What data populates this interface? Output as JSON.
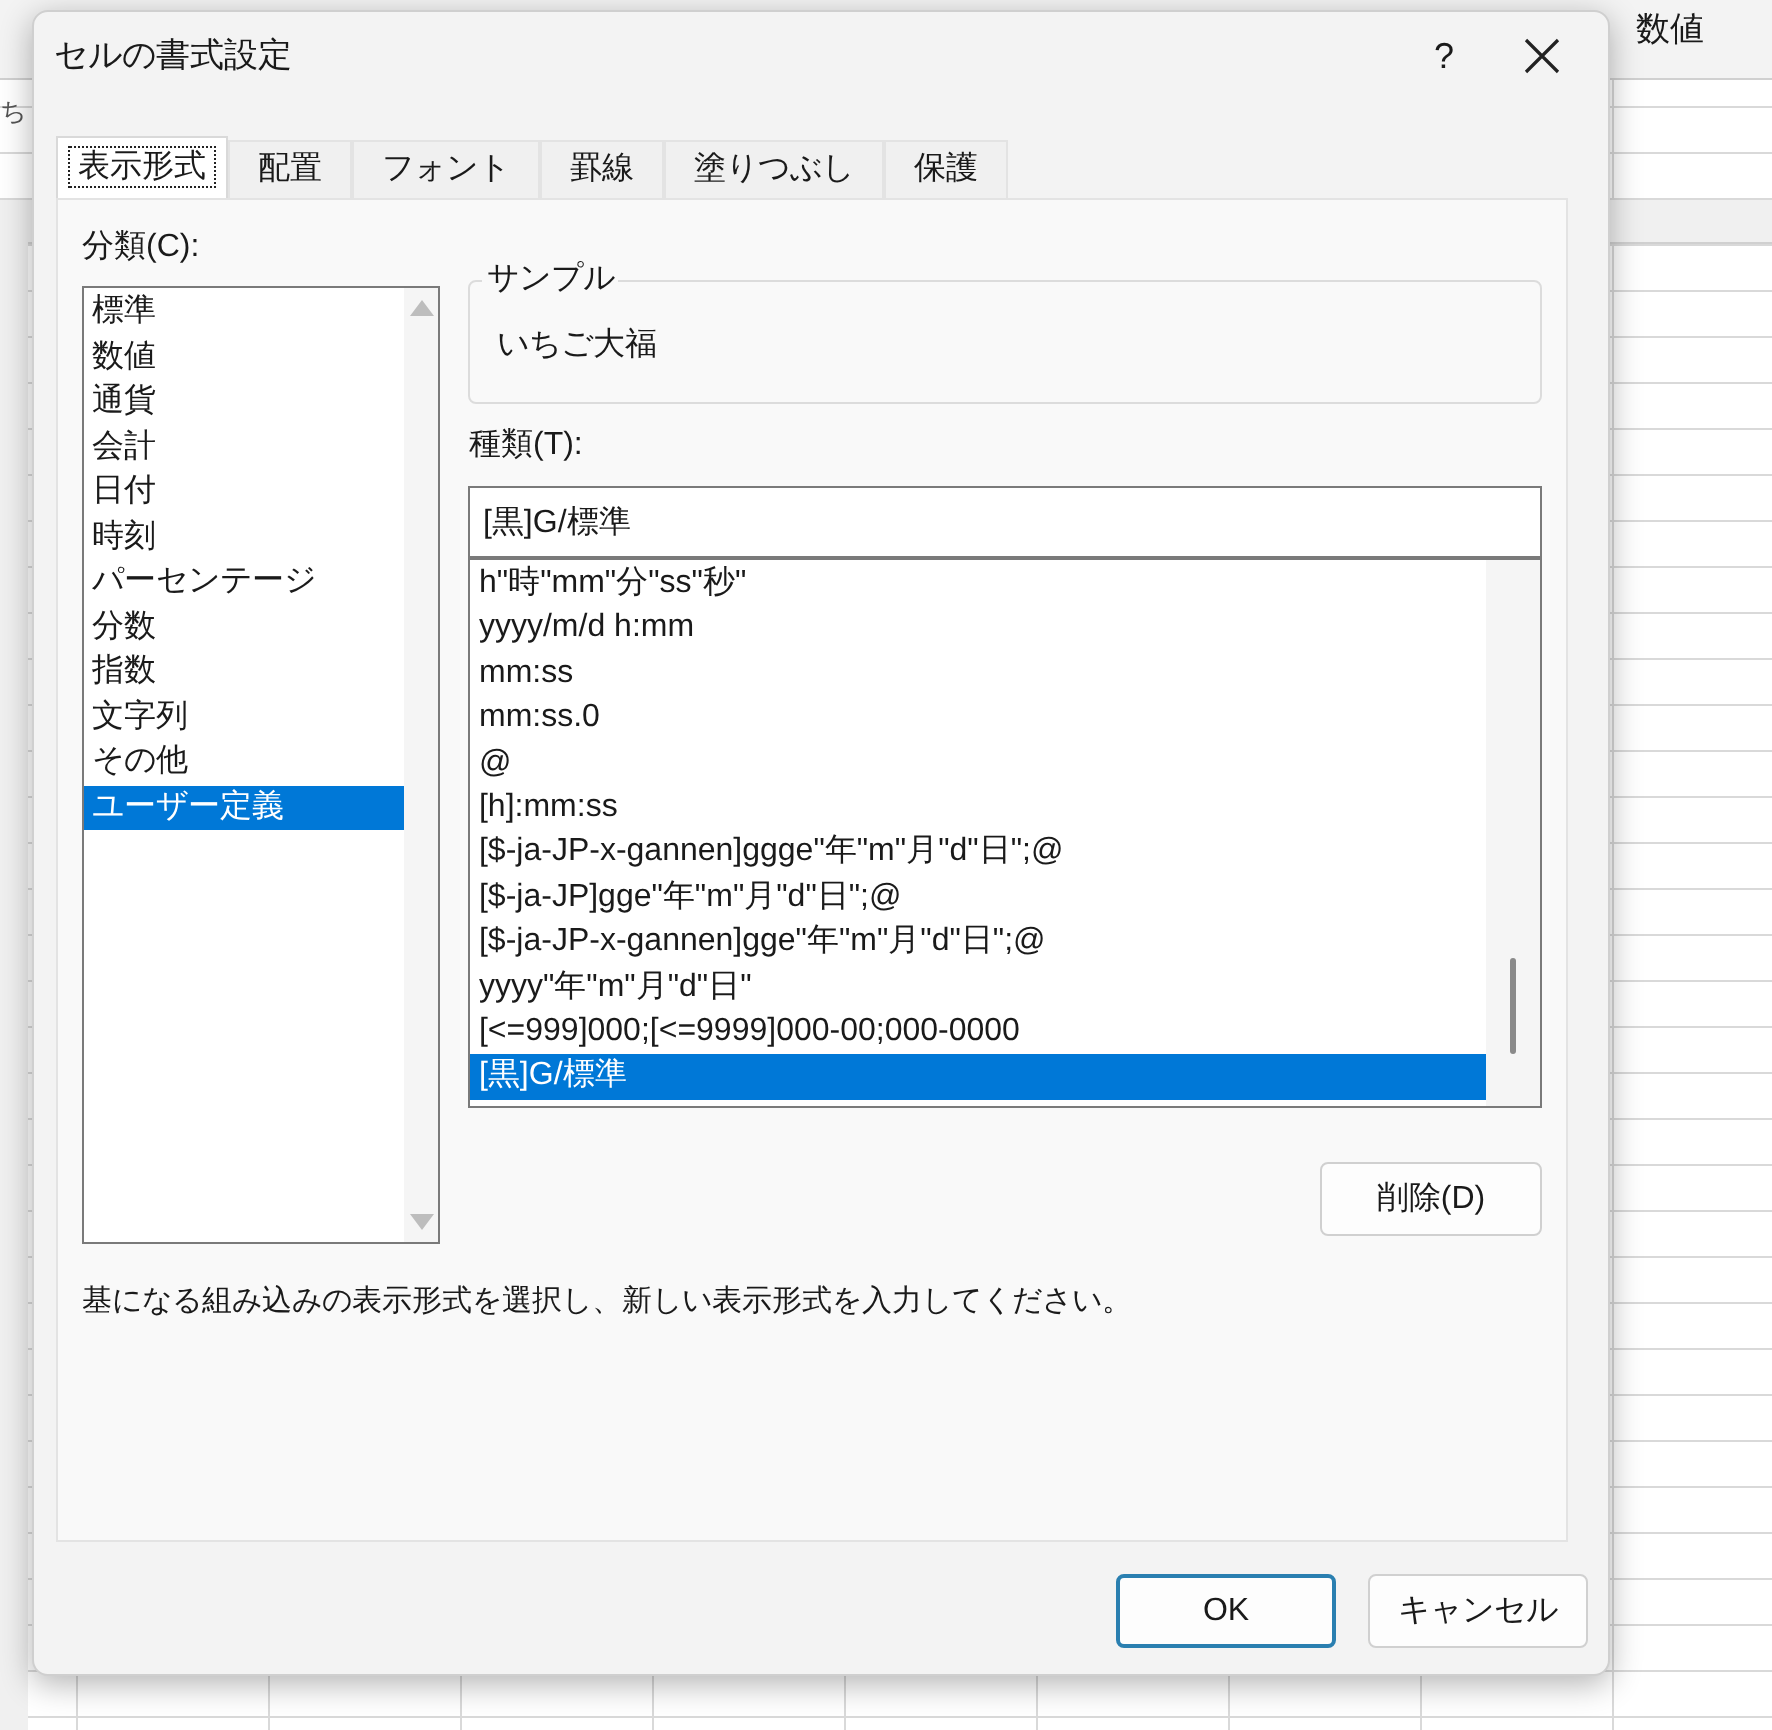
{
  "background_sheet": {
    "header_text": "数値",
    "row_text": "ち"
  },
  "window": {
    "title": "セルの書式設定",
    "help": "?"
  },
  "tabs": [
    {
      "label": "表示形式",
      "selected": true
    },
    {
      "label": "配置",
      "selected": false
    },
    {
      "label": "フォント",
      "selected": false
    },
    {
      "label": "罫線",
      "selected": false
    },
    {
      "label": "塗りつぶし",
      "selected": false
    },
    {
      "label": "保護",
      "selected": false
    }
  ],
  "category": {
    "label": "分類(C):",
    "items": [
      {
        "label": "標準",
        "selected": false
      },
      {
        "label": "数値",
        "selected": false
      },
      {
        "label": "通貨",
        "selected": false
      },
      {
        "label": "会計",
        "selected": false
      },
      {
        "label": "日付",
        "selected": false
      },
      {
        "label": "時刻",
        "selected": false
      },
      {
        "label": "パーセンテージ",
        "selected": false
      },
      {
        "label": "分数",
        "selected": false
      },
      {
        "label": "指数",
        "selected": false
      },
      {
        "label": "文字列",
        "selected": false
      },
      {
        "label": "その他",
        "selected": false
      },
      {
        "label": "ユーザー定義",
        "selected": true
      }
    ]
  },
  "sample": {
    "label": "サンプル",
    "value": "いちご大福"
  },
  "type": {
    "label": "種類(T):",
    "value": "[黒]G/標準",
    "items": [
      {
        "label": "h\"時\"mm\"分\"ss\"秒\"",
        "selected": false
      },
      {
        "label": "yyyy/m/d h:mm",
        "selected": false
      },
      {
        "label": "mm:ss",
        "selected": false
      },
      {
        "label": "mm:ss.0",
        "selected": false
      },
      {
        "label": "@",
        "selected": false
      },
      {
        "label": "[h]:mm:ss",
        "selected": false
      },
      {
        "label": "[$-ja-JP-x-gannen]ggge\"年\"m\"月\"d\"日\";@",
        "selected": false
      },
      {
        "label": "[$-ja-JP]gge\"年\"m\"月\"d\"日\";@",
        "selected": false
      },
      {
        "label": "[$-ja-JP-x-gannen]gge\"年\"m\"月\"d\"日\";@",
        "selected": false
      },
      {
        "label": "yyyy\"年\"m\"月\"d\"日\"",
        "selected": false
      },
      {
        "label": "[<=999]000;[<=9999]000-00;000-0000",
        "selected": false
      },
      {
        "label": "[黒]G/標準",
        "selected": true
      }
    ]
  },
  "delete_button": "削除(D)",
  "description": "基になる組み込みの表示形式を選択し、新しい表示形式を入力してください。",
  "buttons": [
    {
      "label": "OK",
      "kind": "default"
    },
    {
      "label": "キャンセル",
      "kind": "normal"
    }
  ]
}
